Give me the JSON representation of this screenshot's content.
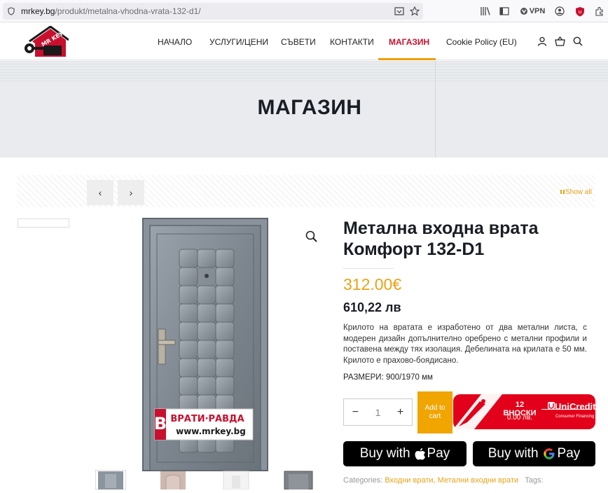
{
  "browser": {
    "url_domain": "mrkey.bg",
    "url_path": "/produkt/metalna-vhodna-vrata-132-d1/",
    "vpn_label": "VPN"
  },
  "nav": {
    "items": [
      "НАЧАЛО",
      "УСЛУГИ/ЦЕНИ",
      "СЪВЕТИ",
      "КОНТАКТИ",
      "МАГАЗИН",
      "Cookie Policy (EU)"
    ],
    "active": "МАГАЗИН"
  },
  "banner": {
    "title": "МАГАЗИН"
  },
  "pager": {
    "prev": "‹",
    "next": "›",
    "show_all": "Show all"
  },
  "product": {
    "title": "Метална входна врата Комфорт 132-D1",
    "price": "312.00€",
    "price_bgn": "610,22 лв",
    "description": "Крилото на вратата е изработено от два метални листа, с модерен дизайн допълнително оребрено с метални профили и поставена между тях изолация. Дебелината на крилата е 50 мм. Крилото е прахово-боядисано.",
    "size_label": "РАЗМЕРИ:",
    "size_value": "900/1970 мм",
    "quantity": "1",
    "qty_minus": "−",
    "qty_plus": "+",
    "add_to_cart": "Add to cart",
    "image_watermark_brand": "ВРАТИ·РАВДА",
    "image_watermark_url": "www.mrkey.bg"
  },
  "unicredit": {
    "installments": "12 ВНОСКИ",
    "amount": "0.00 лв.",
    "brand": "UniCredit",
    "sub": "Consumer Financing"
  },
  "pay": {
    "apple_label": "Buy with",
    "apple_brand": "Pay",
    "google_label": "Buy with",
    "google_brand": "Pay"
  },
  "meta": {
    "categories_label": "Categories:",
    "categories": "Входни врати, Метални входни врати",
    "tags_label": "Tags:"
  },
  "colors": {
    "accent": "#e8a317",
    "active_nav": "#c8102e",
    "unicredit": "#e2001a"
  }
}
